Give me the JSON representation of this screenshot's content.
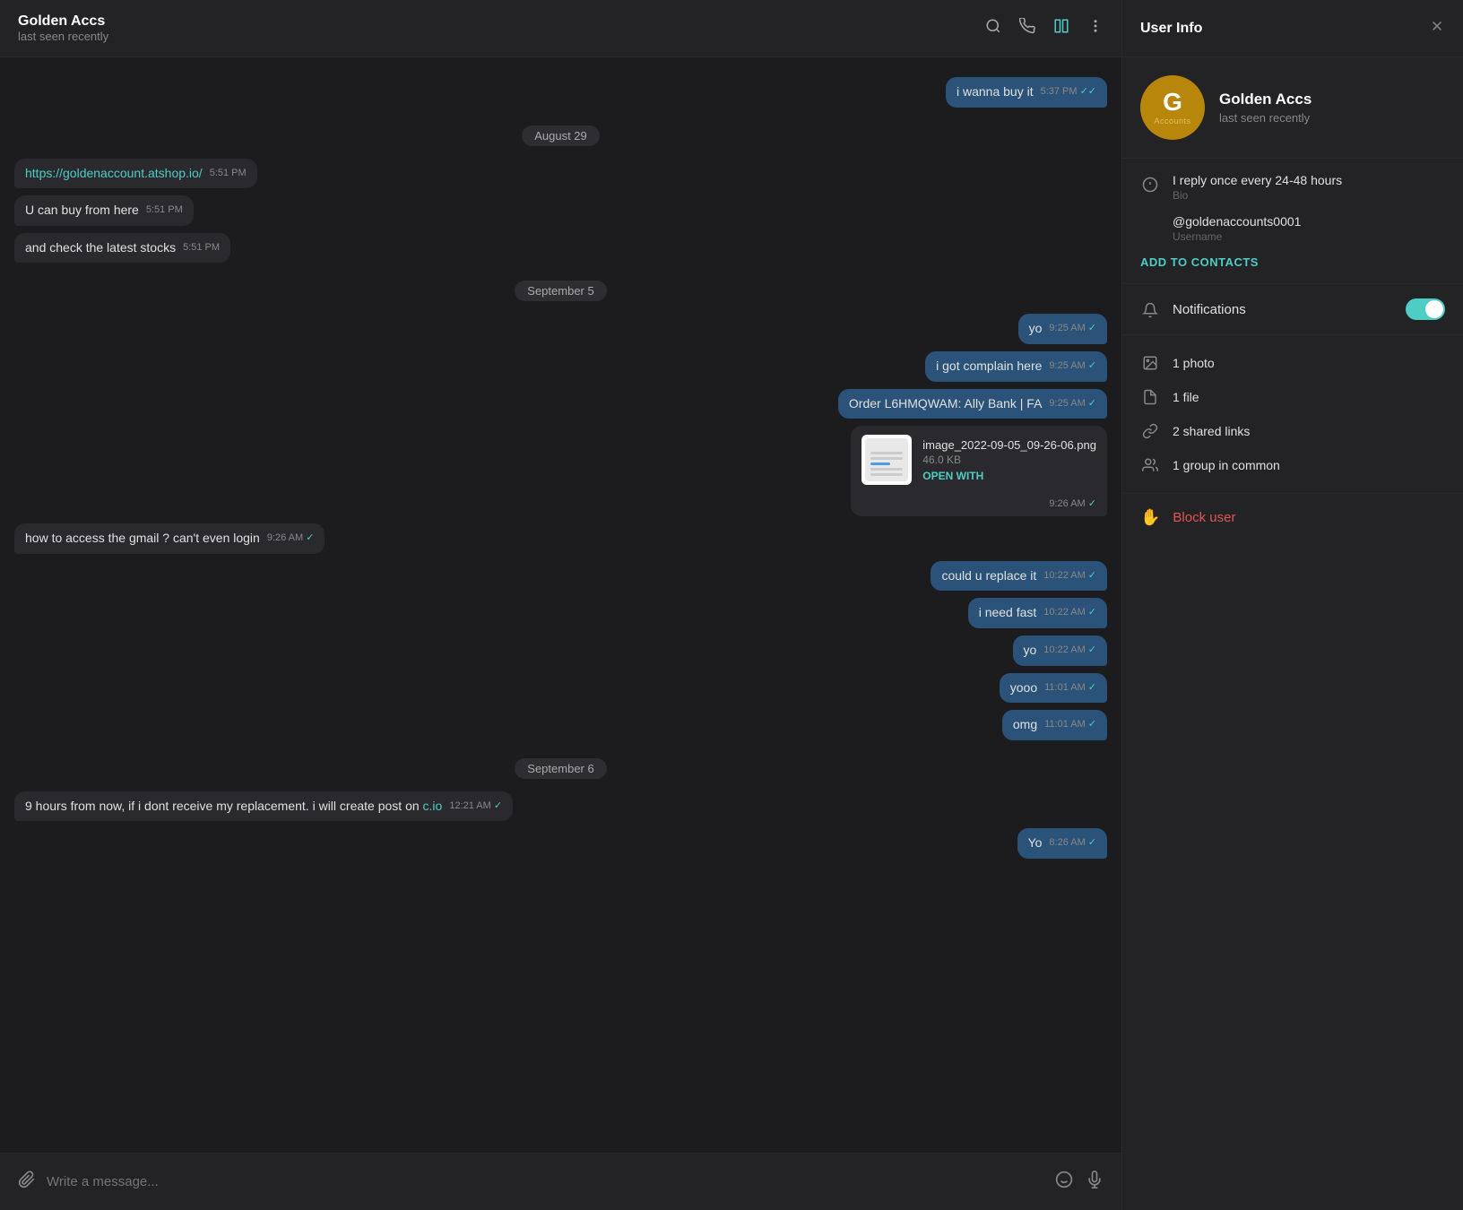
{
  "header": {
    "name": "Golden Accs",
    "status": "last seen recently",
    "icons": {
      "search": "🔍",
      "call": "📞",
      "layout": "⊡",
      "more": "⋮"
    }
  },
  "messages": [
    {
      "id": "msg1",
      "type": "sent",
      "text": "i wanna buy it",
      "time": "5:37 PM",
      "checked": true
    },
    {
      "id": "date1",
      "type": "date",
      "text": "August 29"
    },
    {
      "id": "msg2",
      "type": "received",
      "text": "https://goldenaccount.atshop.io/",
      "time": "5:51 PM",
      "isLink": true
    },
    {
      "id": "msg3",
      "type": "received",
      "text": "U can buy from here",
      "time": "5:51 PM"
    },
    {
      "id": "msg4",
      "type": "received",
      "text": "and check the latest stocks",
      "time": "5:51 PM"
    },
    {
      "id": "date2",
      "type": "date",
      "text": "September 5"
    },
    {
      "id": "msg5",
      "type": "sent",
      "text": "yo",
      "time": "9:25 AM",
      "checked": true
    },
    {
      "id": "msg6",
      "type": "sent",
      "text": "i got complain here",
      "time": "9:25 AM",
      "checked": true
    },
    {
      "id": "msg7",
      "type": "sent",
      "text": "Order L6HMQWAM: Ally Bank | FA",
      "time": "9:25 AM",
      "checked": true
    },
    {
      "id": "msg8",
      "type": "file",
      "fileName": "image_2022-09-05_09-26-06.png",
      "fileSize": "46.0 KB",
      "openLabel": "OPEN WITH",
      "time": "9:26 AM",
      "checked": true
    },
    {
      "id": "msg9",
      "type": "received",
      "text": "how to access the gmail ? can't even login",
      "time": "9:26 AM",
      "checked": true
    },
    {
      "id": "msg10",
      "type": "sent",
      "text": "could u replace it",
      "time": "10:22 AM",
      "checked": true
    },
    {
      "id": "msg11",
      "type": "sent",
      "text": "i need fast",
      "time": "10:22 AM",
      "checked": true
    },
    {
      "id": "msg12",
      "type": "sent",
      "text": "yo",
      "time": "10:22 AM",
      "checked": true
    },
    {
      "id": "msg13",
      "type": "sent",
      "text": "yooo",
      "time": "11:01 AM",
      "checked": true
    },
    {
      "id": "msg14",
      "type": "sent",
      "text": "omg",
      "time": "11:01 AM",
      "checked": true
    },
    {
      "id": "date3",
      "type": "date",
      "text": "September 6"
    },
    {
      "id": "msg15",
      "type": "received",
      "text": "9 hours from now, if i dont receive my replacement. i will create post on",
      "textLink": "c.io",
      "time": "12:21 AM",
      "checked": true
    },
    {
      "id": "msg16",
      "type": "sent",
      "text": "Yo",
      "time": "8:26 AM",
      "checked": true
    }
  ],
  "input": {
    "placeholder": "Write a message...",
    "attachIcon": "📎",
    "emojiIcon": "🙂",
    "micIcon": "🎤"
  },
  "userInfo": {
    "title": "User Info",
    "avatar": {
      "letter": "G",
      "sub": "Accounts",
      "color": "#b8860b"
    },
    "name": "Golden Accs",
    "status": "last seen recently",
    "bio": "I reply once every 24-48 hours",
    "bioLabel": "Bio",
    "username": "@goldenaccounts0001",
    "usernameLabel": "Username",
    "addToContacts": "ADD TO CONTACTS",
    "notifications": "Notifications",
    "media": [
      {
        "icon": "photo",
        "text": "1 photo"
      },
      {
        "icon": "file",
        "text": "1 file"
      },
      {
        "icon": "link",
        "text": "2 shared links"
      },
      {
        "icon": "group",
        "text": "1 group in common"
      }
    ],
    "blockUser": "Block user"
  }
}
